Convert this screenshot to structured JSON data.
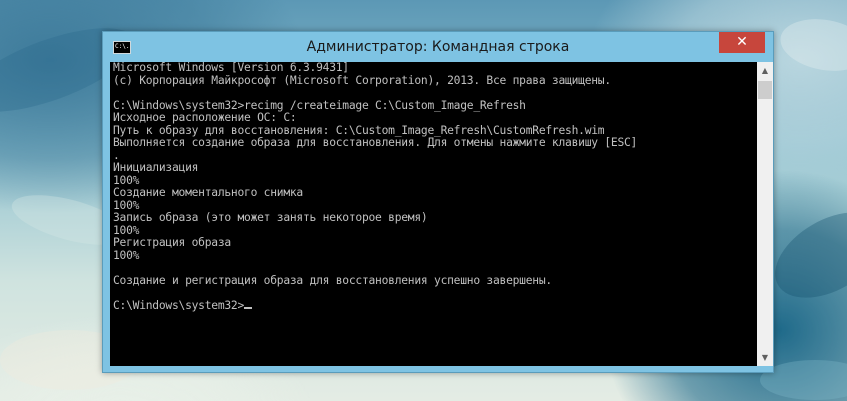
{
  "window": {
    "title": "Администратор: Командная строка",
    "icon_name": "cmd-icon",
    "icon_text": "C:\\.",
    "close_label": "✕",
    "accent_color": "#7ec3e3",
    "close_color": "#c7463c"
  },
  "console": {
    "lines": [
      "Microsoft Windows [Version 6.3.9431]",
      "(c) Корпорация Майкрософт (Microsoft Corporation), 2013. Все права защищены.",
      "",
      "C:\\Windows\\system32>recimg /createimage C:\\Custom_Image_Refresh",
      "Исходное расположение ОС: C:",
      "Путь к образу для восстановления: C:\\Custom_Image_Refresh\\CustomRefresh.wim",
      "Выполняется создание образа для восстановления. Для отмены нажмите клавишу [ESC]",
      ".",
      "Инициализация",
      "100%",
      "Создание моментального снимка",
      "100%",
      "Запись образа (это может занять некоторое время)",
      "100%",
      "Регистрация образа",
      "100%",
      "",
      "Создание и регистрация образа для восстановления успешно завершены.",
      "",
      "C:\\Windows\\system32>"
    ]
  },
  "scrollbar": {
    "up_icon": "▲",
    "down_icon": "▼"
  }
}
